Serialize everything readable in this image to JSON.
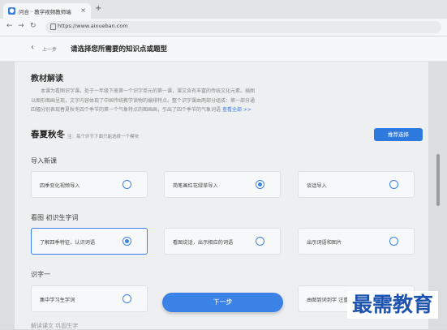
{
  "browser": {
    "tab_title": "问合 · 教学视频教师端",
    "new_tab": "+",
    "close": "×",
    "url": "https://www.aixueban.com"
  },
  "header": {
    "back": "上一步",
    "title": "请选择您所需要的知识点或题型"
  },
  "section_intro": {
    "title": "教材解读",
    "lines": [
      "本课为看图识字课。处于一年级下册第一个识字单元的第一课，课文含有丰富的传统文化元素。插图",
      "以图形图画呈现，文字内容体现了中国传统教学读物的编排特点。整个识字课由两部分组成：第一部分通",
      "四幅分别表现春夏秋冬四个季节的第一个气象特点的图画画，引出了四个季节的气象词语"
    ],
    "more": "查看全部 >>"
  },
  "group": {
    "title": "春夏秋冬",
    "note": "注：每个环节下面只能选择一个模块",
    "recommend_button": "推荐选择"
  },
  "sections": [
    {
      "title": "导入新课",
      "options": [
        {
          "label": "四季变化视频导入",
          "selected": false
        },
        {
          "label": "简笔画红花绿草导入",
          "selected": true
        },
        {
          "label": "谈话导入",
          "selected": false
        }
      ]
    },
    {
      "title": "看图 初识生字词",
      "options": [
        {
          "label": "了解四季特征，认识词语",
          "selected": true
        },
        {
          "label": "看图说话，出示相应的词语",
          "selected": false
        },
        {
          "label": "出示词语和图片",
          "selected": false
        }
      ]
    },
    {
      "title": "识字一",
      "options": [
        {
          "label": "集中学习生字词",
          "selected": false
        },
        {
          "label": "由图到词到字 注重",
          "selected": false
        }
      ]
    }
  ],
  "footer": {
    "next_button": "下一步",
    "next_section_partial": "解读课文 巩固生字"
  },
  "watermark": "最需教育",
  "colors": {
    "accent": "#3b82e6",
    "watermark": "#1e54ad"
  }
}
